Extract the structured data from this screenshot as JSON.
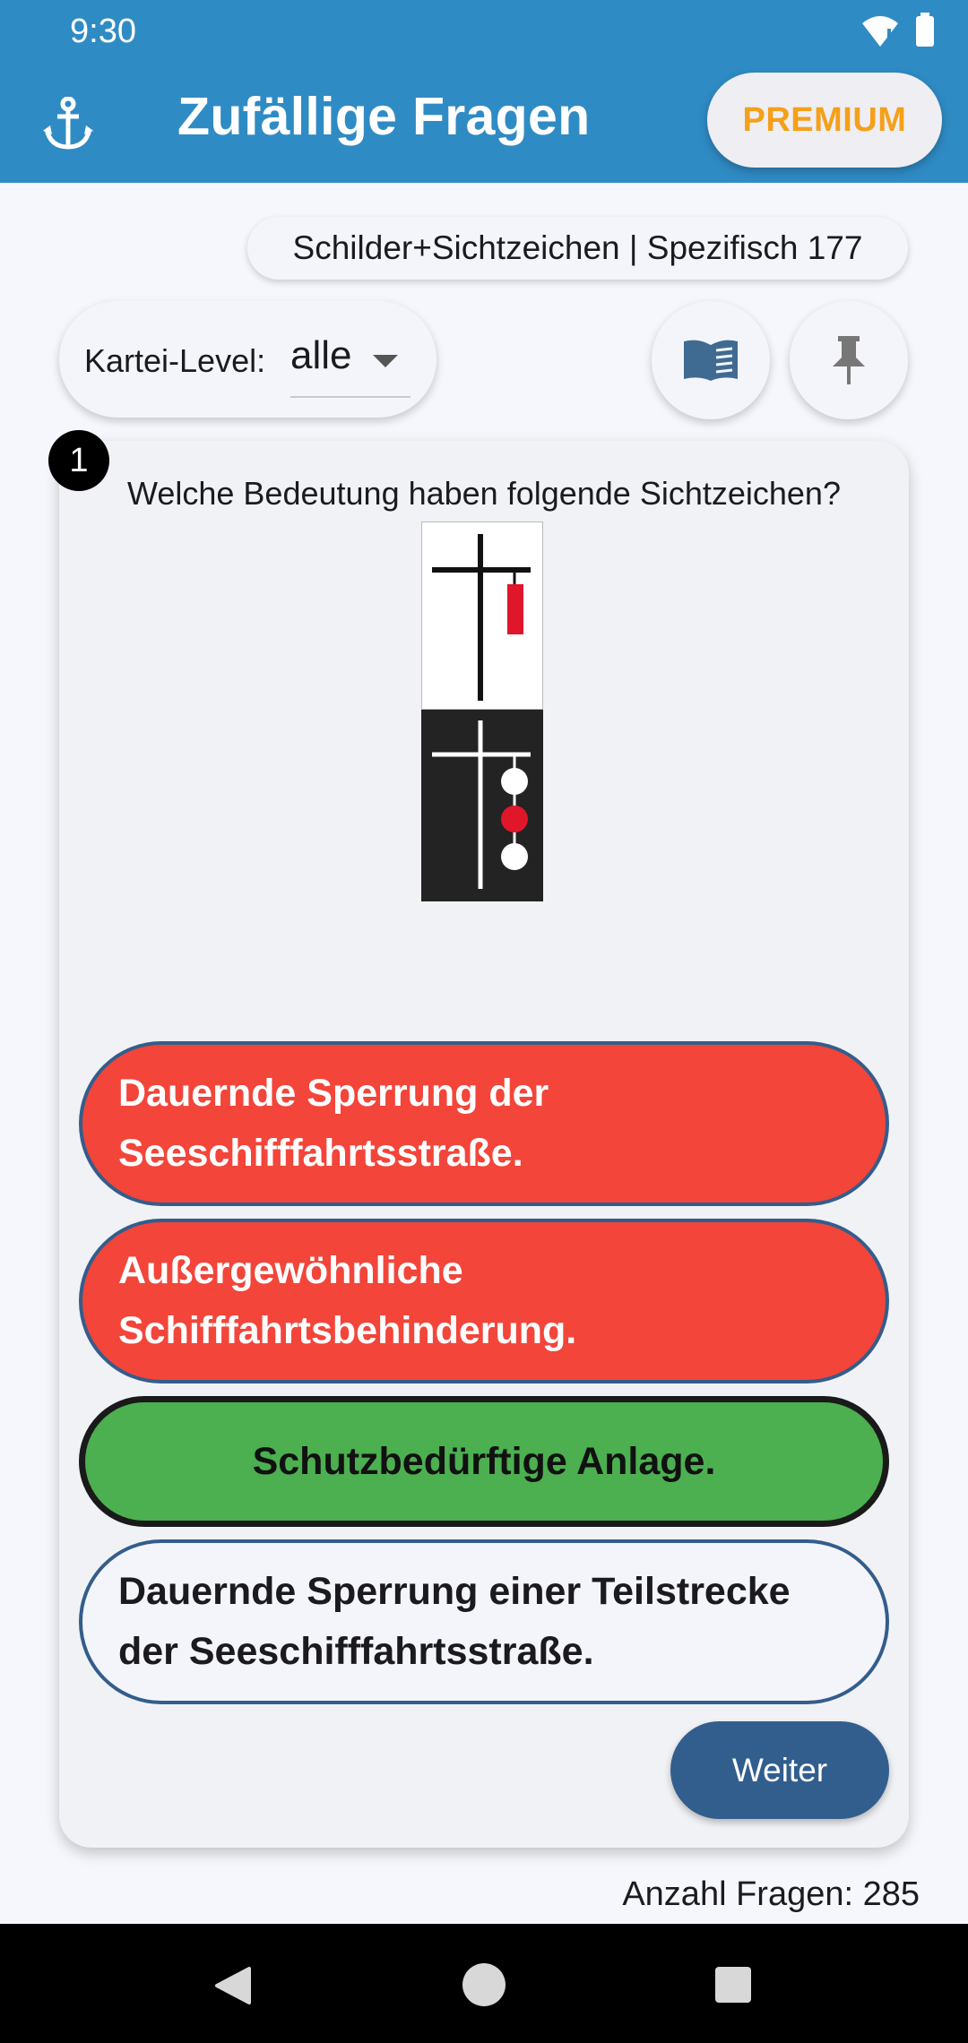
{
  "status": {
    "time": "9:30"
  },
  "appbar": {
    "title": "Zufällige Fragen",
    "premium_label": "PREMIUM",
    "nav_icon": "anchor-icon"
  },
  "category_chip": "Schilder+Sichtzeichen | Spezifisch 177",
  "level": {
    "label": "Kartei-Level:",
    "value": "alle"
  },
  "actions": {
    "book_icon": "book-icon",
    "pin_icon": "pin-icon"
  },
  "question": {
    "number": "1",
    "text": "Welche Bedeutung haben folgende Sichtzeichen?"
  },
  "answers": [
    {
      "text": "Dauernde Sperrung der Seeschifffahrtsstraße.",
      "state": "wrong"
    },
    {
      "text": "Außergewöhnliche Schifffahrtsbehinderung.",
      "state": "wrong"
    },
    {
      "text": "Schutzbedürftige Anlage.",
      "state": "correct"
    },
    {
      "text": "Dauernde Sperrung einer Teilstrecke der Seeschifffahrtsstraße.",
      "state": "neutral"
    }
  ],
  "next_label": "Weiter",
  "footer": {
    "count_text": "Anzahl Fragen: 285"
  },
  "colors": {
    "appbar": "#2f8bc4",
    "premium_text": "#f5a01a",
    "wrong": "#f3453a",
    "correct": "#4caf50",
    "button": "#325e8e"
  }
}
